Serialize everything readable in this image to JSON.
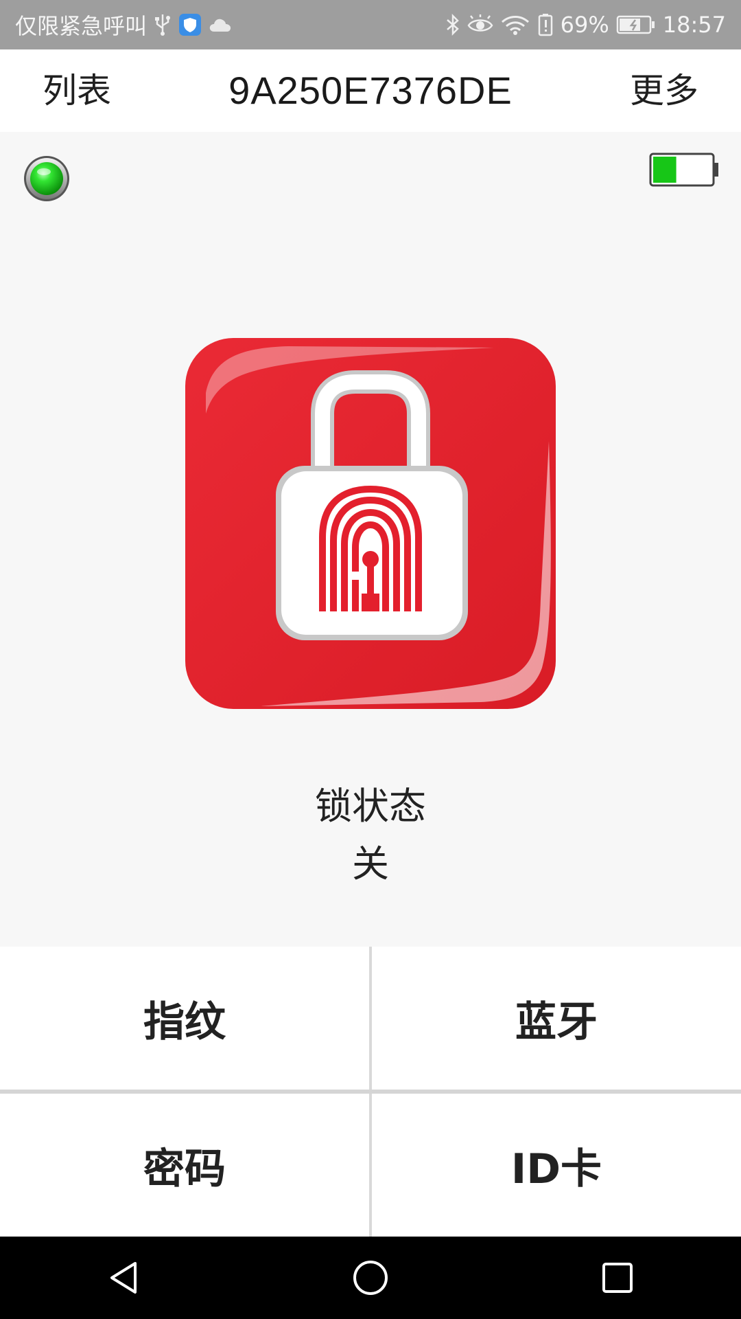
{
  "status_bar": {
    "carrier_text": "仅限紧急呼叫",
    "battery_percent": "69%",
    "time": "18:57"
  },
  "app_bar": {
    "left_label": "列表",
    "title": "9A250E7376DE",
    "right_label": "更多"
  },
  "device": {
    "connection_color": "#22cc22",
    "battery_fraction": 0.4,
    "battery_fill_color": "#17c617"
  },
  "lock": {
    "status_label": "锁状态",
    "status_value": "关",
    "tile_color": "#e3202d"
  },
  "actions": {
    "fingerprint": "指纹",
    "bluetooth": "蓝牙",
    "password": "密码",
    "id_card": "ID卡"
  }
}
